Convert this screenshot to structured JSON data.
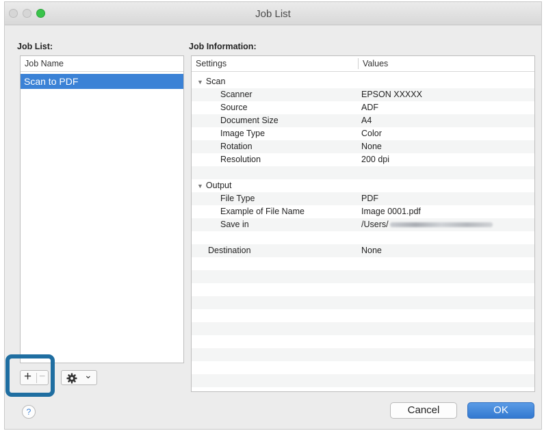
{
  "window": {
    "title": "Job List"
  },
  "job_list": {
    "label": "Job List:",
    "column_header": "Job Name",
    "items": [
      {
        "label": "Scan to PDF"
      }
    ]
  },
  "job_info": {
    "label": "Job Information:",
    "columns": {
      "settings": "Settings",
      "values": "Values"
    },
    "scan": {
      "label": "Scan",
      "rows": [
        {
          "key": "Scanner",
          "value": "EPSON XXXXX"
        },
        {
          "key": "Source",
          "value": "ADF"
        },
        {
          "key": "Document Size",
          "value": "A4"
        },
        {
          "key": "Image Type",
          "value": "Color"
        },
        {
          "key": "Rotation",
          "value": "None"
        },
        {
          "key": "Resolution",
          "value": "200 dpi"
        }
      ]
    },
    "output": {
      "label": "Output",
      "rows": [
        {
          "key": "File Type",
          "value": "PDF"
        },
        {
          "key": "Example of File Name",
          "value": "Image 0001.pdf"
        },
        {
          "key": "Save in",
          "value": "/Users/"
        }
      ]
    },
    "destination": {
      "key": "Destination",
      "value": "None"
    }
  },
  "toolbar": {
    "add": "+",
    "remove": "−",
    "gear_caret": "⌄"
  },
  "buttons": {
    "help": "?",
    "cancel": "Cancel",
    "ok": "OK"
  },
  "colors": {
    "selection": "#3b82d6",
    "ok_button": "#3b82d6",
    "highlight_box": "#1f6ea1"
  }
}
